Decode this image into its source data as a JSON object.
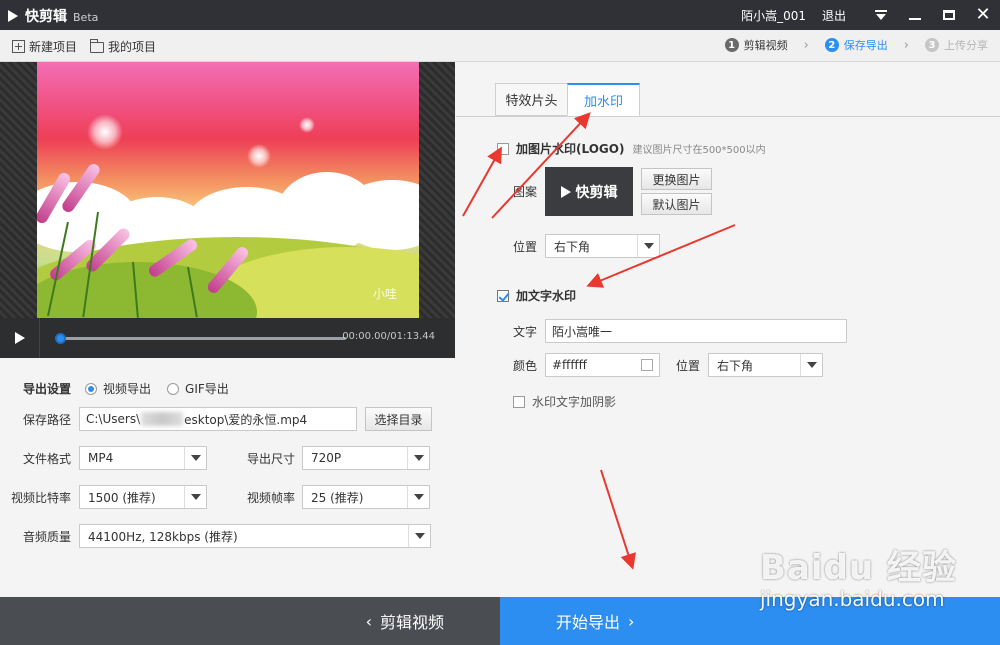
{
  "titlebar": {
    "app_name": "快剪辑",
    "beta": "Beta",
    "username": "陌小嵩_001",
    "logout": "退出"
  },
  "toolbar": {
    "new_project": "新建项目",
    "my_projects": "我的项目",
    "steps": [
      {
        "num": "1",
        "label": "剪辑视频",
        "state": "done"
      },
      {
        "num": "2",
        "label": "保存导出",
        "state": "active"
      },
      {
        "num": "3",
        "label": "上传分享",
        "state": "todo"
      }
    ]
  },
  "preview": {
    "frame_watermark": "小哇",
    "time": "00:00.00/01:13.44",
    "progress": 0
  },
  "export": {
    "settings_label": "导出设置",
    "video_export": "视频导出",
    "gif_export": "GIF导出",
    "selected_mode": "视频导出",
    "save_path_label": "保存路径",
    "save_path_prefix": "C:\\Users\\",
    "save_path_suffix": "esktop\\爱的永恒.mp4",
    "choose_dir": "选择目录",
    "format_label": "文件格式",
    "format_value": "MP4",
    "size_label": "导出尺寸",
    "size_value": "720P",
    "bitrate_label": "视频比特率",
    "bitrate_value": "1500 (推荐)",
    "framerate_label": "视频帧率",
    "framerate_value": "25 (推荐)",
    "audio_label": "音频质量",
    "audio_value": "44100Hz, 128kbps (推荐)"
  },
  "tabs": [
    {
      "label": "特效片头",
      "active": false
    },
    {
      "label": "加水印",
      "active": true
    }
  ],
  "watermark": {
    "image_label": "加图片水印(LOGO)",
    "image_hint": "建议图片尺寸在500*500以内",
    "image_checked": false,
    "pattern_label": "图案",
    "logo_text": "快剪辑",
    "replace_image": "更换图片",
    "default_image": "默认图片",
    "image_position_label": "位置",
    "image_position_value": "右下角",
    "text_label": "加文字水印",
    "text_checked": true,
    "text_field_label": "文字",
    "text_value": "陌小嵩唯一",
    "color_label": "颜色",
    "color_value": "#ffffff",
    "text_position_label": "位置",
    "text_position_value": "右下角",
    "shadow_label": "水印文字加阴影",
    "shadow_checked": false
  },
  "bottom": {
    "back_label": "剪辑视频",
    "next_label": "开始导出"
  },
  "watermark_overlay": {
    "line1": "Baidu 经验",
    "line2": "jingyan.baidu.com"
  },
  "colors": {
    "accent": "#2b8ef0",
    "titlebar": "#2f3136",
    "annotation": "#e8382f"
  }
}
